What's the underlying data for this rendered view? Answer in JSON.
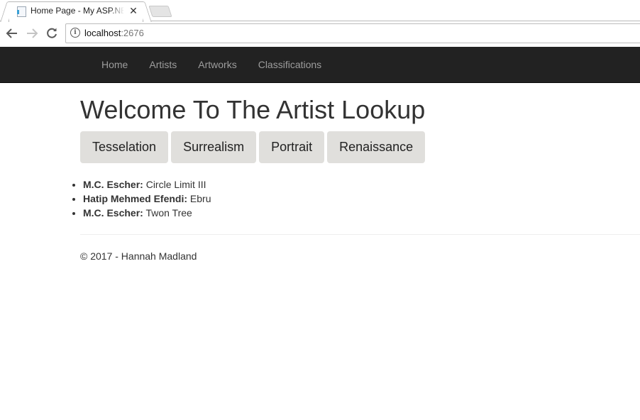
{
  "browser": {
    "tab_title": "Home Page - My ASP.NET Application",
    "close_glyph": "✕",
    "url_host": "localhost",
    "url_port": ":2676"
  },
  "navbar": {
    "items": [
      {
        "label": "Home"
      },
      {
        "label": "Artists"
      },
      {
        "label": "Artworks"
      },
      {
        "label": "Classifications"
      }
    ]
  },
  "main": {
    "heading": "Welcome To The Artist Lookup",
    "category_buttons": [
      {
        "label": "Tesselation"
      },
      {
        "label": "Surrealism"
      },
      {
        "label": "Portrait"
      },
      {
        "label": "Renaissance"
      }
    ],
    "results": [
      {
        "artist": "M.C. Escher:",
        "artwork": " Circle Limit III"
      },
      {
        "artist": "Hatip Mehmed Efendi:",
        "artwork": " Ebru"
      },
      {
        "artist": "M.C. Escher:",
        "artwork": " Twon Tree"
      }
    ]
  },
  "footer": {
    "text": "© 2017 - Hannah Madland"
  },
  "colors": {
    "navbar_bg": "#222222",
    "navbar_link": "#9d9d9d",
    "button_bg": "#e0dfdc",
    "text": "#333333"
  }
}
